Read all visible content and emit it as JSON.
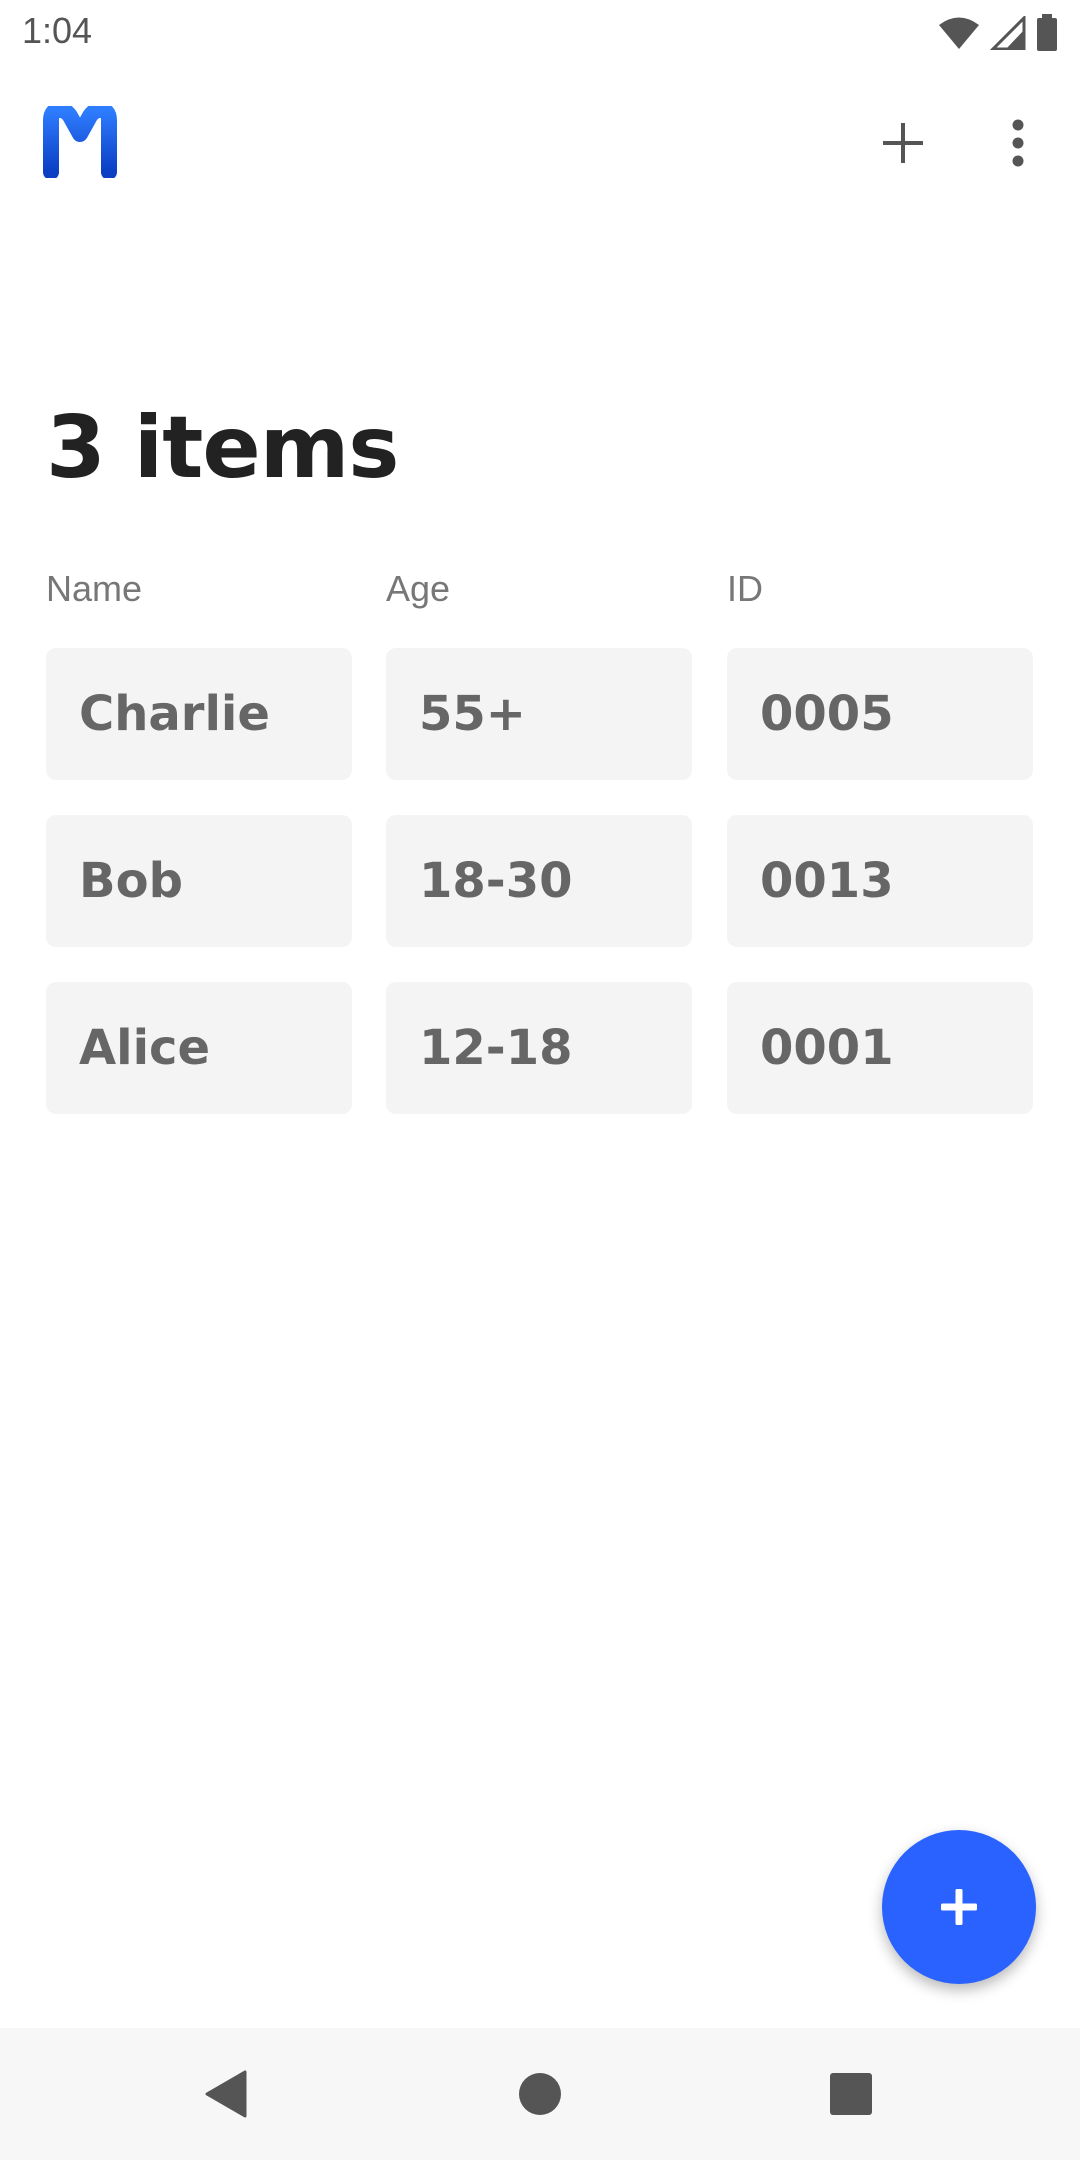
{
  "status_bar": {
    "time": "1:04",
    "icons": [
      "wifi-icon",
      "cell-signal-icon",
      "battery-icon"
    ]
  },
  "app_bar": {
    "logo": "m-logo",
    "actions": [
      "plus-icon",
      "more-vertical-icon"
    ]
  },
  "page": {
    "title": "3 items"
  },
  "table": {
    "headers": [
      "Name",
      "Age",
      "ID"
    ],
    "rows": [
      [
        "Charlie",
        "55+",
        "0005"
      ],
      [
        "Bob",
        "18-30",
        "0013"
      ],
      [
        "Alice",
        "12-18",
        "0001"
      ]
    ]
  },
  "fab": {
    "icon": "plus-icon"
  },
  "nav_bar": {
    "buttons": [
      "back-icon",
      "home-icon",
      "recents-icon"
    ]
  },
  "colors": {
    "accent": "#2962ff",
    "cell_background": "#f4f4f4",
    "title_text": "#222222"
  }
}
